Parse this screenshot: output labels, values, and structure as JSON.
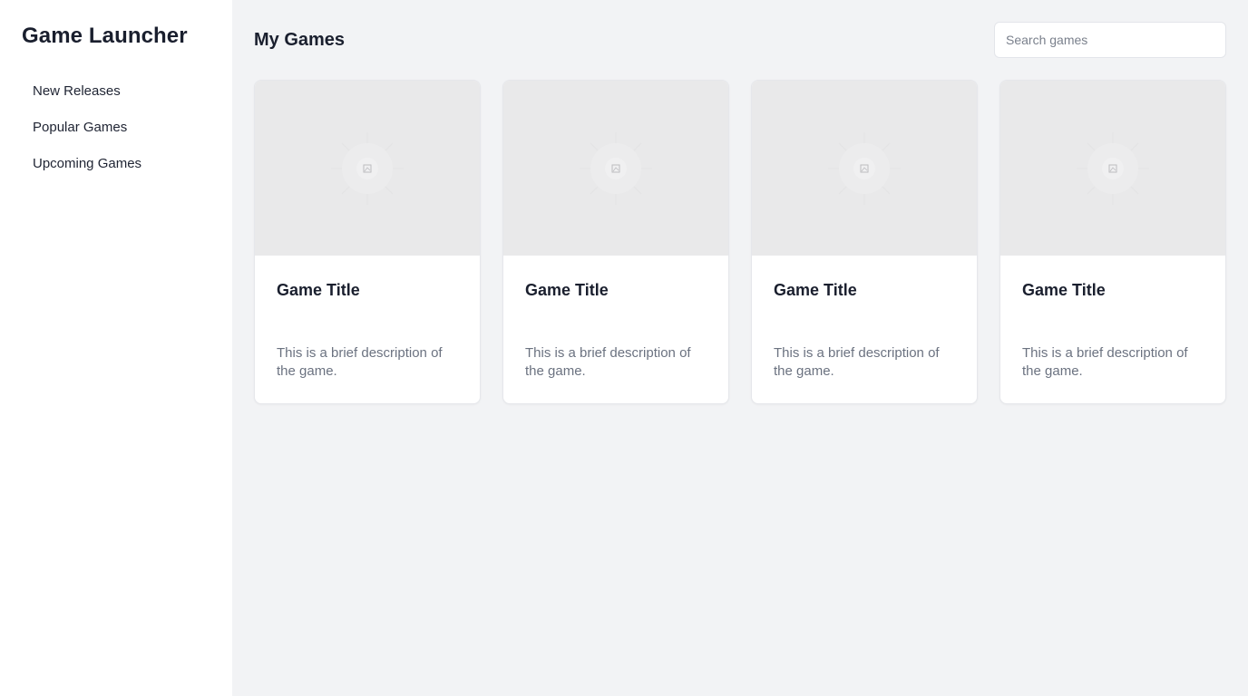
{
  "sidebar": {
    "title": "Game Launcher",
    "items": [
      {
        "label": "New Releases"
      },
      {
        "label": "Popular Games"
      },
      {
        "label": "Upcoming Games"
      }
    ]
  },
  "header": {
    "title": "My Games",
    "search_placeholder": "Search games"
  },
  "games": [
    {
      "title": "Game Title",
      "description": "This is a brief description of the game.",
      "image_icon": "image-placeholder-icon"
    },
    {
      "title": "Game Title",
      "description": "This is a brief description of the game.",
      "image_icon": "image-placeholder-icon"
    },
    {
      "title": "Game Title",
      "description": "This is a brief description of the game.",
      "image_icon": "image-placeholder-icon"
    },
    {
      "title": "Game Title",
      "description": "This is a brief description of the game.",
      "image_icon": "image-placeholder-icon"
    }
  ],
  "colors": {
    "sidebar_bg": "#ffffff",
    "main_bg": "#f2f3f5",
    "image_placeholder_bg": "#e9e9ea",
    "description_text": "#6b7280"
  }
}
